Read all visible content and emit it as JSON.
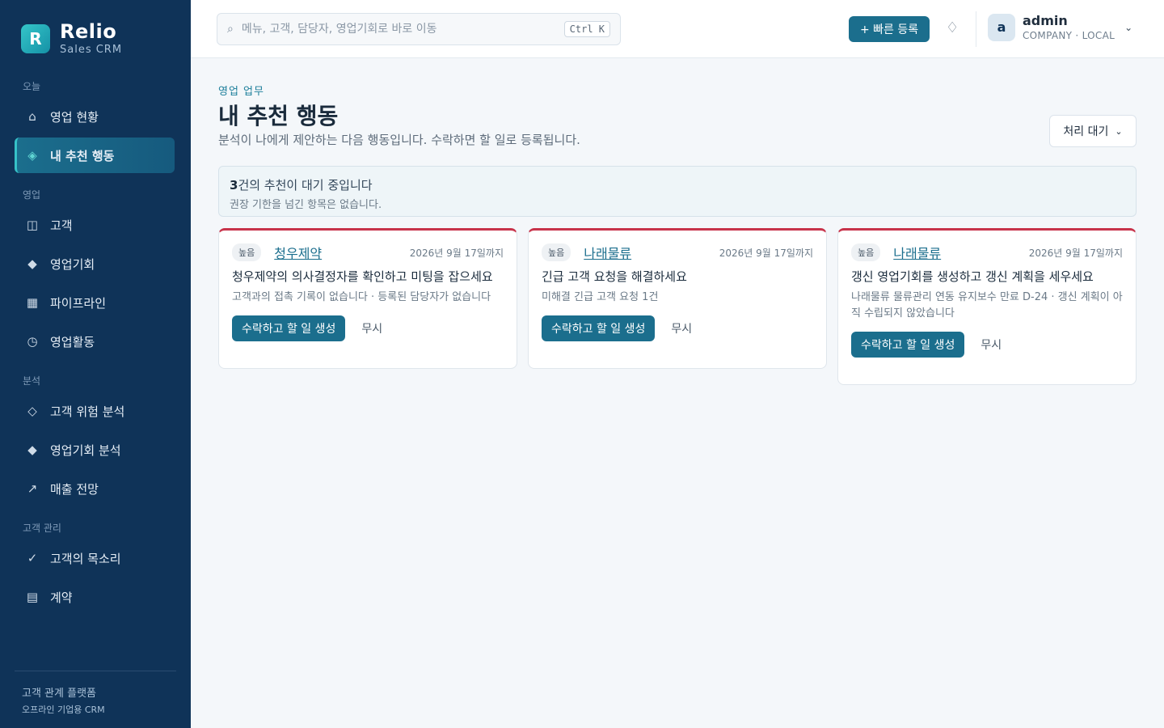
{
  "brand": {
    "logo_letter": "R",
    "name": "Relio",
    "sub": "Sales CRM"
  },
  "sidebar": {
    "sections": [
      "오늘",
      "영업",
      "분석",
      "고객 관리"
    ],
    "items": [
      {
        "label": "영업 현황",
        "icon": "home-icon"
      },
      {
        "label": "내 추천 행동",
        "icon": "diamond-icon",
        "active": true
      },
      {
        "label": "고객",
        "icon": "columns-icon"
      },
      {
        "label": "영업기회",
        "icon": "diamond-filled-icon"
      },
      {
        "label": "파이프라인",
        "icon": "grid-icon"
      },
      {
        "label": "영업활동",
        "icon": "clock-icon"
      },
      {
        "label": "고객 위험 분석",
        "icon": "diamond-outline-icon"
      },
      {
        "label": "영업기회 분석",
        "icon": "diamond-filled-icon"
      },
      {
        "label": "매출 전망",
        "icon": "trend-arrow-icon"
      },
      {
        "label": "고객의 목소리",
        "icon": "check-icon"
      },
      {
        "label": "계약",
        "icon": "document-icon"
      }
    ],
    "footer": {
      "line1": "고객 관계 플랫폼",
      "line2": "오프라인 기업용 CRM"
    }
  },
  "topbar": {
    "search_placeholder": "메뉴, 고객, 담당자, 영업기회로 바로 이동",
    "shortcut": "Ctrl K",
    "quick_add": "+ 빠른 등록",
    "user": {
      "avatar": "a",
      "name": "admin",
      "org": "COMPANY · LOCAL"
    }
  },
  "main": {
    "crumb": "영업 업무",
    "title": "내 추천 행동",
    "desc": "분석이 나에게 제안하는 다음 행동입니다. 수락하면 할 일로 등록됩니다.",
    "filter": "처리 대기",
    "notice": {
      "count": "3",
      "line1_rest": "건의 추천이 대기 중입니다",
      "line2": "권장 기한을 넘긴 항목은 없습니다."
    },
    "cards": [
      {
        "priority": "높음",
        "customer": "청우제약",
        "due": "2026년 9월 17일까지",
        "title": "청우제약의 의사결정자를 확인하고 미팅을 잡으세요",
        "sub": "고객과의 접촉 기록이 없습니다 · 등록된 담당자가 없습니다",
        "accept": "수락하고 할 일 생성",
        "ignore": "무시"
      },
      {
        "priority": "높음",
        "customer": "나래물류",
        "due": "2026년 9월 17일까지",
        "title": "긴급 고객 요청을 해결하세요",
        "sub": "미해결 긴급 고객 요청 1건",
        "accept": "수락하고 할 일 생성",
        "ignore": "무시"
      },
      {
        "priority": "높음",
        "customer": "나래물류",
        "due": "2026년 9월 17일까지",
        "title": "갱신 영업기회를 생성하고 갱신 계획을 세우세요",
        "sub": "나래물류 물류관리 연동 유지보수 만료 D-24 · 갱신 계획이 아직 수립되지 않았습니다",
        "accept": "수락하고 할 일 생성",
        "ignore": "무시"
      }
    ]
  },
  "colors": {
    "sidebar": "#0f3358",
    "accent": "#1b6e8d",
    "priority_border": "#c8334a",
    "brand_teal": "#35c6c9"
  }
}
